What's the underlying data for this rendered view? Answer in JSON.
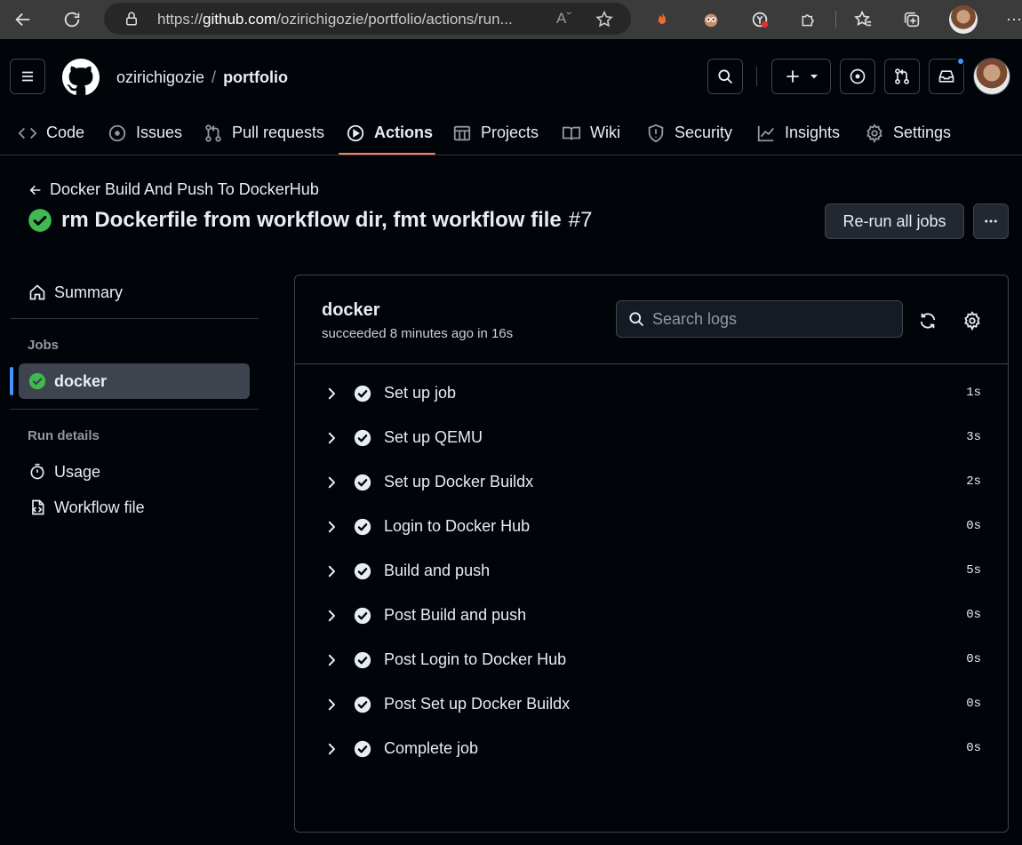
{
  "browser": {
    "url_prefix": "https://",
    "url_domain": "github.com",
    "url_path": "/ozirichigozie/portfolio/actions/run..."
  },
  "header": {
    "owner": "ozirichigozie",
    "separator": "/",
    "repo": "portfolio"
  },
  "tabs": [
    {
      "label": "Code",
      "icon": "code-icon"
    },
    {
      "label": "Issues",
      "icon": "issue-icon"
    },
    {
      "label": "Pull requests",
      "icon": "pull-request-icon"
    },
    {
      "label": "Actions",
      "icon": "play-icon",
      "active": true
    },
    {
      "label": "Projects",
      "icon": "table-icon"
    },
    {
      "label": "Wiki",
      "icon": "book-icon"
    },
    {
      "label": "Security",
      "icon": "shield-icon"
    },
    {
      "label": "Insights",
      "icon": "graph-icon"
    },
    {
      "label": "Settings",
      "icon": "gear-icon"
    }
  ],
  "page": {
    "back_label": "Docker Build And Push To DockerHub",
    "run_title": "rm Dockerfile from workflow dir, fmt workflow file",
    "run_number": "#7",
    "rerun_label": "Re-run all jobs"
  },
  "sidebar": {
    "summary_label": "Summary",
    "jobs_heading": "Jobs",
    "job_label": "docker",
    "run_details_heading": "Run details",
    "usage_label": "Usage",
    "workflow_file_label": "Workflow file"
  },
  "job": {
    "name": "docker",
    "status": "succeeded 8 minutes ago in 16s",
    "search_placeholder": "Search logs",
    "steps": [
      {
        "label": "Set up job",
        "duration": "1s"
      },
      {
        "label": "Set up QEMU",
        "duration": "3s"
      },
      {
        "label": "Set up Docker Buildx",
        "duration": "2s"
      },
      {
        "label": "Login to Docker Hub",
        "duration": "0s"
      },
      {
        "label": "Build and push",
        "duration": "5s"
      },
      {
        "label": "Post Build and push",
        "duration": "0s"
      },
      {
        "label": "Post Login to Docker Hub",
        "duration": "0s"
      },
      {
        "label": "Post Set up Docker Buildx",
        "duration": "0s"
      },
      {
        "label": "Complete job",
        "duration": "0s"
      }
    ]
  },
  "colors": {
    "success": "#3fb950",
    "accent_underline": "#f78166",
    "link_blue": "#4493f8"
  }
}
